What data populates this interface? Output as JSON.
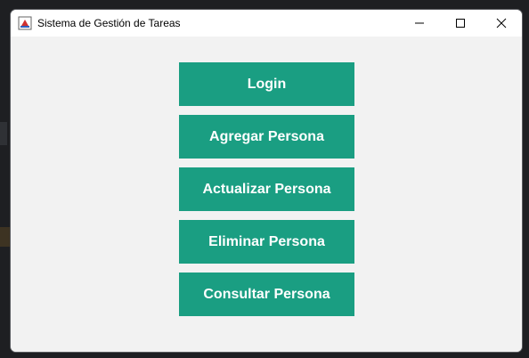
{
  "window": {
    "title": "Sistema de Gestión de Tareas",
    "controls": {
      "minimize_icon": "minimize-icon",
      "maximize_icon": "maximize-icon",
      "close_icon": "close-icon"
    }
  },
  "menu": {
    "buttons": [
      {
        "label": "Login"
      },
      {
        "label": "Agregar Persona"
      },
      {
        "label": "Actualizar Persona"
      },
      {
        "label": "Eliminar Persona"
      },
      {
        "label": "Consultar Persona"
      }
    ]
  },
  "colors": {
    "button_bg": "#1a9e82",
    "button_text": "#ffffff",
    "window_bg": "#f2f2f2",
    "titlebar_bg": "#ffffff"
  }
}
